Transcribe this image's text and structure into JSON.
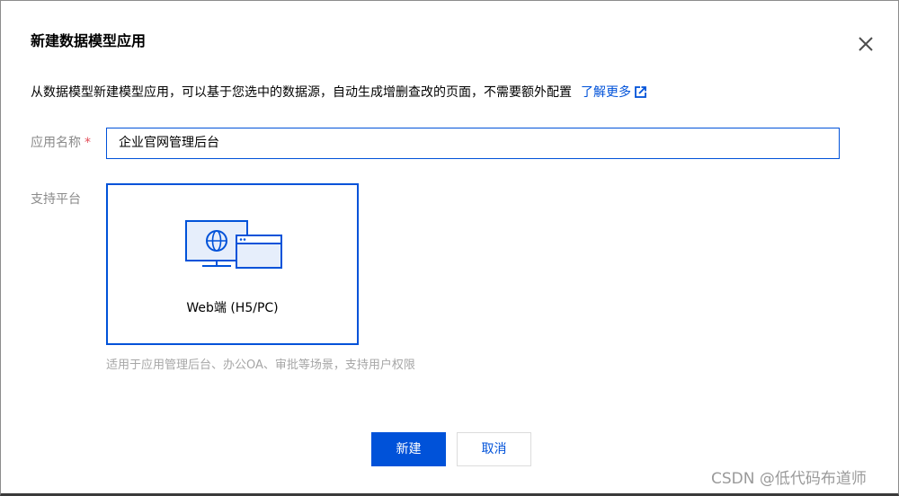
{
  "dialog": {
    "title": "新建数据模型应用",
    "description": "从数据模型新建模型应用，可以基于您选中的数据源，自动生成增删查改的页面，不需要额外配置",
    "learn_more": "了解更多",
    "close_icon": "close-icon",
    "link_icon": "external-link-icon"
  },
  "form": {
    "app_name_label": "应用名称",
    "required_mark": "*",
    "app_name_value": "企业官网管理后台",
    "platform_label": "支持平台",
    "platform_option": {
      "label": "Web端 (H5/PC)",
      "icon": "web-platform-illustration",
      "selected": true
    },
    "platform_hint": "适用于应用管理后台、办公OA、审批等场景，支持用户权限"
  },
  "actions": {
    "create_label": "新建",
    "cancel_label": "取消"
  },
  "watermark": "CSDN @低代码布道师",
  "colors": {
    "accent": "#0052d9",
    "required": "#e34d59",
    "muted_text": "#8a8a8a"
  }
}
